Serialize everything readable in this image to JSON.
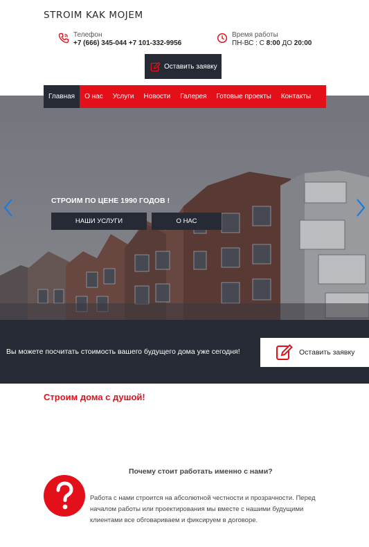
{
  "site": {
    "logo": "STROIM KAK MOJEM"
  },
  "contact": {
    "phone_label": "Телефон",
    "phones": "+7 (666) 345-044 +7 101-332-9956",
    "hours_label": "Время работы",
    "hours_days": "ПН-ВС : С",
    "hours_from": "8:00",
    "hours_to_word": "ДО",
    "hours_to": "20:00"
  },
  "header": {
    "order_button": "Оставить заявку"
  },
  "nav": {
    "items": [
      {
        "label": "Главная"
      },
      {
        "label": "О нас"
      },
      {
        "label": "Услуги"
      },
      {
        "label": "Новости"
      },
      {
        "label": "Галерея"
      },
      {
        "label": "Готовые проекты"
      },
      {
        "label": "Контакты"
      }
    ]
  },
  "hero": {
    "title": "СТРОИМ ПО ЦЕНЕ 1990 ГОДОВ !",
    "btn_services": "НАШИ УСЛУГИ",
    "btn_about": "О НАС"
  },
  "cta": {
    "text": "Вы можете посчитать стоимость вашего будущего дома уже сегодня!",
    "button": "Оставить заявку"
  },
  "main": {
    "subheading": "Строим дома с душой!",
    "why_title": "Почему стоит работать именно с нами?",
    "why_text": "Работа с нами строится на абсолютной честности и прозрачности. Перед началом работы или проектирования мы вместе с нашими будущими клиентами все обговариваем и фиксируем в договоре."
  },
  "colors": {
    "accent": "#e3101a",
    "dark": "#262a35"
  },
  "icons": [
    "phone-icon",
    "clock-icon",
    "edit-icon",
    "chevron-left-icon",
    "chevron-right-icon",
    "question-icon"
  ]
}
